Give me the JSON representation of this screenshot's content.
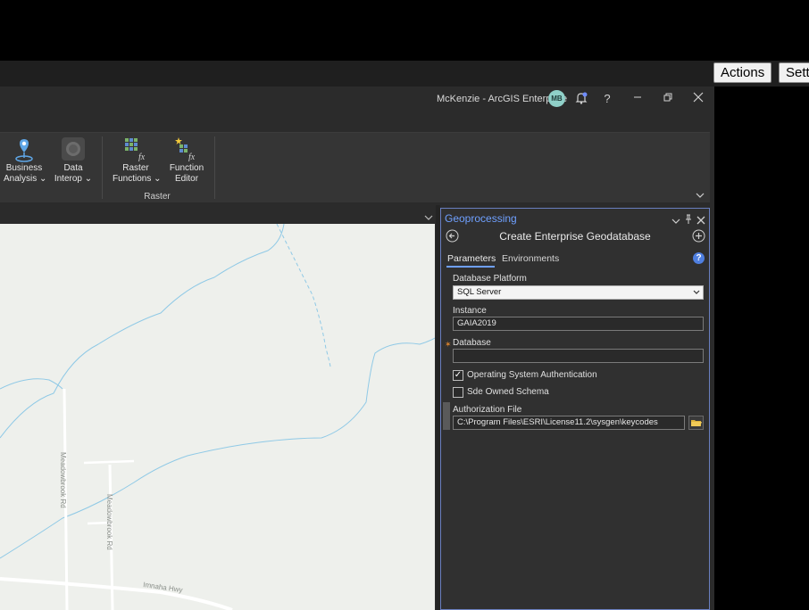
{
  "web_bar": {
    "actions_label": "Actions",
    "settings_label": "Sett"
  },
  "titlebar": {
    "user_portal": "McKenzie - ArcGIS Enterprise",
    "avatar_initials": "MB",
    "help_label": "?"
  },
  "ribbon": {
    "buttons": [
      {
        "line1": "Business",
        "line2": "Analysis ⌄"
      },
      {
        "line1": "Data",
        "line2": "Interop ⌄"
      },
      {
        "line1": "Raster",
        "line2": "Functions ⌄"
      },
      {
        "line1": "Function",
        "line2": "Editor"
      }
    ],
    "group_label": "Raster"
  },
  "map": {
    "road_labels": [
      "Meadowbrook Rd",
      "Meadowbrook Rd",
      "Imnaha Hwy"
    ]
  },
  "geoprocessing": {
    "pane_title": "Geoprocessing",
    "tool_title": "Create Enterprise Geodatabase",
    "tabs": [
      "Parameters",
      "Environments"
    ],
    "help_label": "?",
    "fields": {
      "platform_label": "Database Platform",
      "platform_value": "SQL Server",
      "instance_label": "Instance",
      "instance_value": "GAIA2019",
      "database_label": "Database",
      "database_value": "",
      "os_auth_label": "Operating System Authentication",
      "os_auth_checked": true,
      "sde_schema_label": "Sde Owned Schema",
      "sde_schema_checked": false,
      "auth_file_label": "Authorization File",
      "auth_file_value": "C:\\Program Files\\ESRI\\License11.2\\sysgen\\keycodes"
    }
  },
  "colors": {
    "accent": "#6fa0ff",
    "pane_border": "#6a7fbf",
    "map_bg": "#eef0ec",
    "water": "#8fc9e6",
    "required": "#d9822b"
  }
}
